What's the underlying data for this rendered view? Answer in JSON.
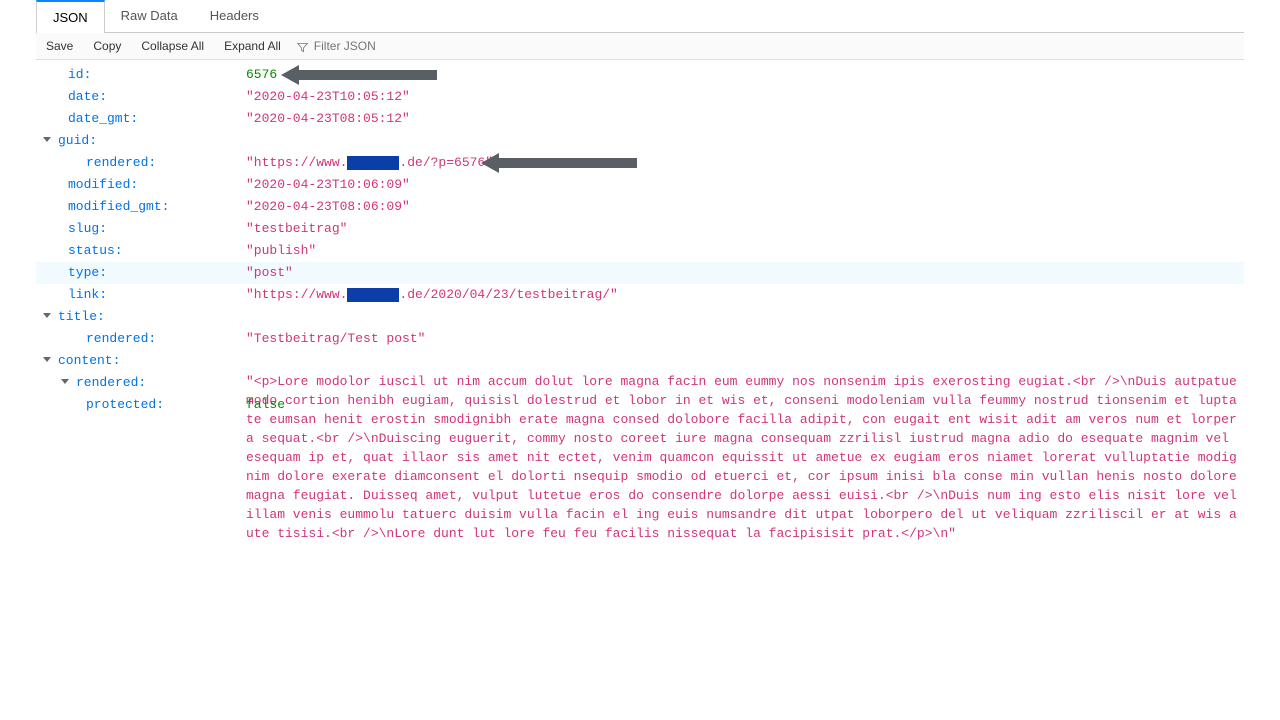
{
  "tabs": {
    "json": "JSON",
    "raw": "Raw Data",
    "headers": "Headers"
  },
  "toolbar": {
    "save": "Save",
    "copy": "Copy",
    "collapseAll": "Collapse All",
    "expandAll": "Expand All",
    "filterPlaceholder": "Filter JSON"
  },
  "json": {
    "id": {
      "key": "id:",
      "value": "6576"
    },
    "date": {
      "key": "date:",
      "value": "\"2020-04-23T10:05:12\""
    },
    "date_gmt": {
      "key": "date_gmt:",
      "value": "\"2020-04-23T08:05:12\""
    },
    "guid": {
      "key": "guid:",
      "rendered": {
        "key": "rendered:",
        "pre": "\"https://www.",
        "post": ".de/?p=6576\""
      }
    },
    "modified": {
      "key": "modified:",
      "value": "\"2020-04-23T10:06:09\""
    },
    "modified_gmt": {
      "key": "modified_gmt:",
      "value": "\"2020-04-23T08:06:09\""
    },
    "slug": {
      "key": "slug:",
      "value": "\"testbeitrag\""
    },
    "status": {
      "key": "status:",
      "value": "\"publish\""
    },
    "type": {
      "key": "type:",
      "value": "\"post\""
    },
    "link": {
      "key": "link:",
      "pre": "\"https://www.",
      "post": ".de/2020/04/23/testbeitrag/\""
    },
    "title": {
      "key": "title:",
      "rendered": {
        "key": "rendered:",
        "value": "\"Testbeitrag/Test post\""
      }
    },
    "content": {
      "key": "content:",
      "rendered": {
        "key": "rendered:",
        "value": "\"<p>Lore modolor iuscil ut nim accum dolut lore magna facin eum eummy nos nonsenim ipis exerosting eugiat.<br />\\nDuis autpatue modo cortion henibh eugiam, quisisl dolestrud et lobor in et wis et, conseni modoleniam vulla feummy nostrud tionsenim et luptate eumsan henit erostin smodignibh erate magna consed dolobore facilla adipit, con eugait ent wisit adit am veros num et lorpera sequat.<br />\\nDuiscing euguerit, commy nosto coreet iure magna consequam zzrilisl iustrud magna adio do esequate magnim vel esequam ip et, quat illaor sis amet nit ectet, venim quamcon equissit ut ametue ex eugiam eros niamet lorerat vulluptatie modignim dolore exerate diamconsent el dolorti nsequip smodio od etuerci et, cor ipsum inisi bla conse min vullan henis nosto dolore magna feugiat. Duisseq amet, vulput lutetue eros do consendre dolorpe aessi euisi.<br />\\nDuis num ing esto elis nisit lore vel illam venis eummolu tatuerc duisim vulla facin el ing euis numsandre dit utpat loborpero del ut veliquam zzriliscil er at wis aute tisisi.<br />\\nLore dunt lut lore feu feu facilis nissequat la facipisisit prat.</p>\\n\""
      },
      "protected": {
        "key": "protected:",
        "value": "false"
      }
    }
  }
}
